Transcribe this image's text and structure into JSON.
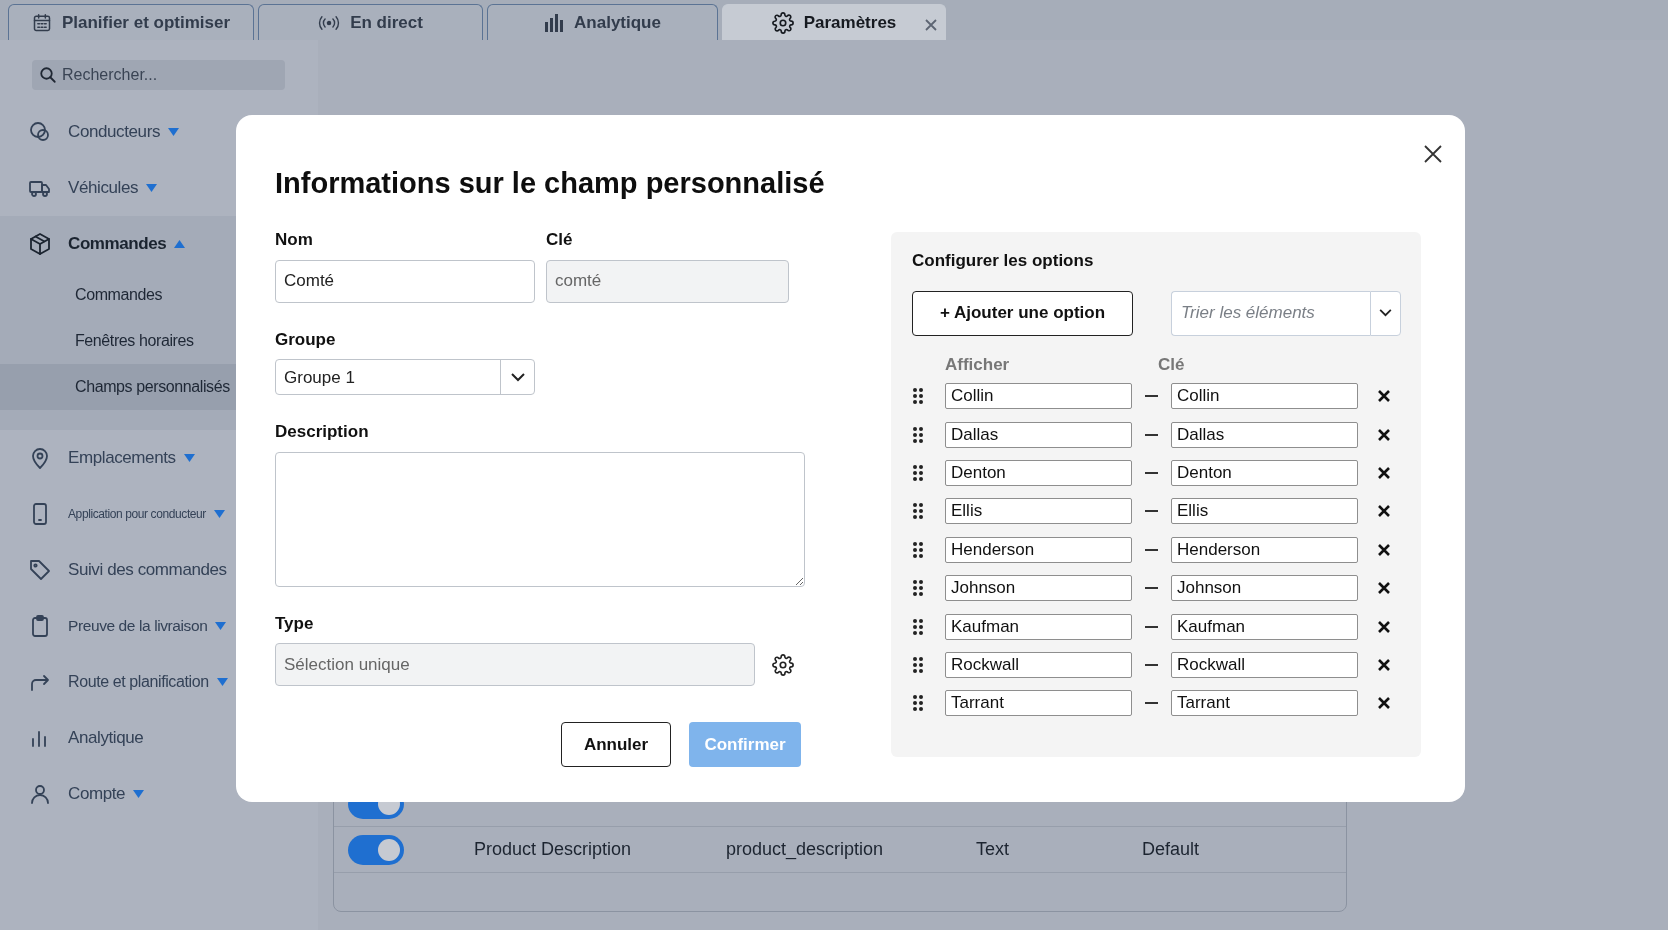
{
  "tabs": [
    {
      "label": "Planifier et optimiser",
      "selected": false,
      "closable": false
    },
    {
      "label": "En direct",
      "selected": false,
      "closable": false
    },
    {
      "label": "Analytique",
      "selected": false,
      "closable": false
    },
    {
      "label": "Paramètres",
      "selected": true,
      "closable": true
    }
  ],
  "sidebar": {
    "search": {
      "placeholder": "Rechercher..."
    },
    "items": [
      {
        "label": "Conducteurs",
        "expandable": true,
        "expanded": false
      },
      {
        "label": "Véhicules",
        "expandable": true,
        "expanded": false
      },
      {
        "label": "Commandes",
        "expandable": true,
        "expanded": true,
        "children": [
          {
            "label": "Commandes",
            "selected": false
          },
          {
            "label": "Fenêtres horaires",
            "selected": false
          },
          {
            "label": "Champs personnalisés",
            "selected": true
          }
        ]
      },
      {
        "label": "Emplacements",
        "expandable": true,
        "expanded": false
      },
      {
        "label": "Application pour conducteur",
        "expandable": true,
        "expanded": false
      },
      {
        "label": "Suivi des commandes",
        "expandable": false,
        "expanded": false
      },
      {
        "label": "Preuve de la livraison",
        "expandable": true,
        "expanded": false
      },
      {
        "label": "Route et planification",
        "expandable": true,
        "expanded": false
      },
      {
        "label": "Analytique",
        "expandable": false,
        "expanded": false
      },
      {
        "label": "Compte",
        "expandable": true,
        "expanded": false
      }
    ]
  },
  "background_table": {
    "rows": [
      {
        "on": true
      },
      {
        "on": true,
        "cells": [
          "Product Description",
          "product_description",
          "Text",
          "Default"
        ]
      }
    ]
  },
  "modal": {
    "title": "Informations sur le champ personnalisé",
    "name": {
      "label": "Nom",
      "value": "Comté"
    },
    "key": {
      "label": "Clé",
      "value": "comté",
      "disabled": true
    },
    "group": {
      "label": "Groupe",
      "value": "Groupe 1"
    },
    "description": {
      "label": "Description"
    },
    "type": {
      "label": "Type",
      "value": "Sélection unique",
      "disabled": true
    },
    "cancel_button": "Annuler",
    "confirm_button": {
      "label": "Confirmer",
      "disabled": true
    },
    "options_panel": {
      "title": "Configurer les options",
      "add_button": "+ Ajouter une option",
      "sort": {
        "placeholder": "Trier les éléments"
      },
      "columns": [
        "Afficher",
        "Clé"
      ],
      "options": [
        {
          "display": "Collin",
          "key": "Collin"
        },
        {
          "display": "Dallas",
          "key": "Dallas"
        },
        {
          "display": "Denton",
          "key": "Denton"
        },
        {
          "display": "Ellis",
          "key": "Ellis"
        },
        {
          "display": "Henderson",
          "key": "Henderson"
        },
        {
          "display": "Johnson",
          "key": "Johnson"
        },
        {
          "display": "Kaufman",
          "key": "Kaufman"
        },
        {
          "display": "Rockwall",
          "key": "Rockwall"
        },
        {
          "display": "Tarrant",
          "key": "Tarrant"
        }
      ]
    }
  }
}
